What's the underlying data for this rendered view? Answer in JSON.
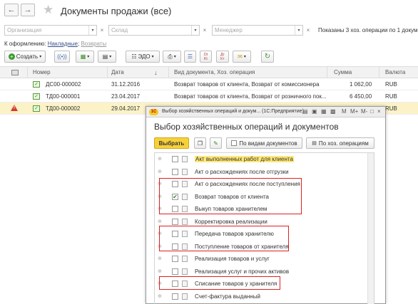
{
  "header": {
    "back_icon": "arrow-left-icon",
    "forward_icon": "arrow-right-icon",
    "favorite_icon": "star-icon",
    "title": "Документы продажи (все)"
  },
  "filters": {
    "organization_placeholder": "Организация",
    "warehouse_placeholder": "Склад",
    "manager_placeholder": "Менеджер",
    "status_text": "Показаны 3 хоз. операции по 1 докум"
  },
  "to_issue": {
    "label": "К оформлению:",
    "link1": "Накладные",
    "sep": ";",
    "link2": "Возвраты"
  },
  "toolbar": {
    "create_label": "Создать",
    "edo_label": "ЭДО"
  },
  "grid": {
    "columns": [
      "Номер",
      "Дата",
      "Вид документа, Хоз. операция",
      "Сумма",
      "Валюта"
    ],
    "rows": [
      {
        "number": "ДС00-000002",
        "date": "31.12.2016",
        "operation": "Возврат товаров от клиента, Возврат от комиссионера",
        "sum": "1 062,00",
        "currency": "RUB",
        "warning": ""
      },
      {
        "number": "ТД00-000001",
        "date": "23.04.2017",
        "operation": "Возврат товаров от клиента, Возврат от розничного пок...",
        "sum": "6 450,00",
        "currency": "RUB",
        "warning": ""
      },
      {
        "number": "ТД00-000002",
        "date": "29.04.2017",
        "operation": "",
        "sum": "",
        "currency": "RUB",
        "warning": "!"
      }
    ]
  },
  "dialog": {
    "window_title": "Выбор хозяйственных операций и докум... (1С:Предприятие)",
    "logo_text": "1С",
    "title_controls": [
      "M",
      "M+",
      "M-",
      "□",
      "×"
    ],
    "heading": "Выбор хозяйственных операций и документов",
    "select_button": "Выбрать",
    "by_doc_types": "По видам документов",
    "by_operations": "По хоз. операциям",
    "items": [
      {
        "label": "Акт выполненных работ для клиента",
        "checked": false,
        "highlight": true
      },
      {
        "label": "Акт о расхождениях после отгрузки",
        "checked": false,
        "highlight": false
      },
      {
        "label": "Акт о расхождениях после поступления",
        "checked": false,
        "highlight": false
      },
      {
        "label": "Возврат товаров от клиента",
        "checked": true,
        "highlight": false
      },
      {
        "label": "Выкуп товаров хранителем",
        "checked": false,
        "highlight": false
      },
      {
        "label": "Корректировка реализации",
        "checked": false,
        "highlight": false
      },
      {
        "label": "Передача товаров хранителю",
        "checked": false,
        "highlight": false
      },
      {
        "label": "Поступление товаров от хранителя",
        "checked": false,
        "highlight": false
      },
      {
        "label": "Реализация товаров и услуг",
        "checked": false,
        "highlight": false
      },
      {
        "label": "Реализация услуг и прочих активов",
        "checked": false,
        "highlight": false
      },
      {
        "label": "Списание товаров у хранителя",
        "checked": false,
        "highlight": false
      },
      {
        "label": "Счет-фактура выданный",
        "checked": false,
        "highlight": false
      }
    ]
  },
  "colors": {
    "accent_yellow": "#f7d13a",
    "selection_row": "#fbf2c8",
    "annotation_red": "#e02020",
    "link": "#3a4f8c",
    "check_green": "#2a8a1a"
  }
}
